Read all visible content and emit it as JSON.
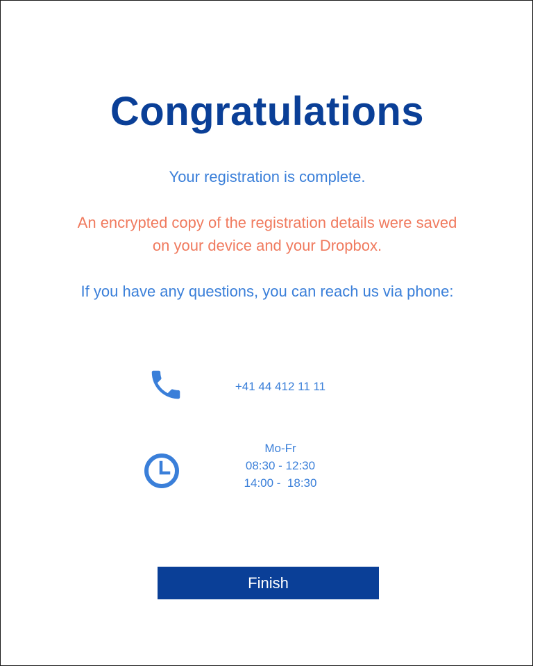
{
  "title": "Congratulations",
  "messages": {
    "complete": "Your registration is complete.",
    "saved": "An encrypted copy of the registration details were saved on your device and your Dropbox.",
    "questions": "If you have any questions, you can reach us via phone:"
  },
  "contact": {
    "phone_icon": "phone-icon",
    "phone_number": "+41 44 412 11 11",
    "clock_icon": "clock-icon",
    "hours": {
      "days": "Mo-Fr",
      "morning": "08:30 - 12:30",
      "afternoon": "14:00 -  18:30"
    }
  },
  "actions": {
    "finish_label": "Finish"
  },
  "colors": {
    "primary": "#0a3f97",
    "accent_blue": "#3a7fd9",
    "warning": "#f07a5e",
    "background": "#ffffff"
  }
}
